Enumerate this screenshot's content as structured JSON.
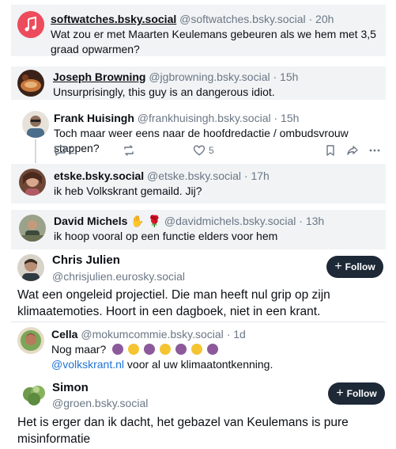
{
  "posts": [
    {
      "name": "softwatches.bsky.social",
      "handle": "@softwatches.bsky.social",
      "time": "· 20h",
      "text": "Wat zou er met Maarten Keulemans gebeuren als we hem met 3,5 graad opwarmen?"
    },
    {
      "name": "Joseph Browning",
      "handle": "@jgbrowning.bsky.social",
      "time": "· 15h",
      "text": "Unsurprisingly, this guy is an dangerous idiot."
    },
    {
      "name": "Frank Huisingh",
      "handle": "@frankhuisingh.bsky.social",
      "time": "· 15h",
      "text": "Toch maar weer eens naar de hoofdredactie / ombudsvrouw stappen?",
      "replies": "2",
      "likes": "5"
    },
    {
      "name": "etske.bsky.social",
      "handle": "@etske.bsky.social",
      "time": "· 17h",
      "text": "ik heb Volkskrant gemaild. Jij?"
    },
    {
      "name": "David Michels",
      "handle": "@davidmichels.bsky.social",
      "time": "· 13h",
      "text": "ik hoop vooral op een functie elders voor hem"
    },
    {
      "name": "Chris Julien",
      "handle": "@chrisjulien.eurosky.social",
      "text": "Wat een ongeleid projectiel. Die man heeft nul grip op zijn klimaatemoties. Hoort in een dagboek, niet in een krant."
    },
    {
      "name": "Cella",
      "handle": "@mokumcommie.bsky.social",
      "time": "· 1d",
      "text_prefix": "Nog maar?",
      "mention": "@volkskrant.nl",
      "text_suffix": "voor al uw klimaatontkenning."
    },
    {
      "name": "Simon",
      "handle": "@groen.bsky.social",
      "text": "Het is erger dan ik dacht, het gebazel van Keulemans is pure misinformatie"
    }
  ],
  "follow_label": "Follow",
  "colors": {
    "card_bg": "#f1f3f5",
    "follow_bg": "#1e2937",
    "link": "#1f73d6",
    "handle": "#6b7785",
    "brand_pink": "#ec4c5c"
  }
}
